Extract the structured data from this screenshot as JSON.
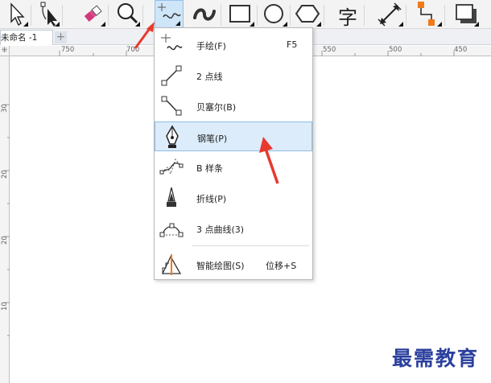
{
  "toolbar": {
    "tools": [
      {
        "name": "pick-tool"
      },
      {
        "name": "shape-tool"
      },
      {
        "name": "crop-tool"
      },
      {
        "name": "zoom-tool"
      },
      {
        "name": "freehand-tool",
        "active": true
      },
      {
        "name": "artistic-media-tool"
      },
      {
        "name": "rectangle-tool"
      },
      {
        "name": "ellipse-tool"
      },
      {
        "name": "polygon-tool"
      },
      {
        "name": "text-tool",
        "glyph": "字"
      },
      {
        "name": "parallel-dimension-tool"
      },
      {
        "name": "connector-tool"
      },
      {
        "name": "shadow-tool"
      }
    ]
  },
  "document": {
    "tab_label": "未命名 -1",
    "add_tab": "+"
  },
  "ruler": {
    "corner_mark": "⁜",
    "h_labels": [
      "750",
      "700",
      "550",
      "500",
      "450"
    ],
    "v_labels": [
      "30",
      "20",
      "20",
      "10"
    ]
  },
  "menu": {
    "items": [
      {
        "icon": "freehand-icon",
        "label": "手绘(F)",
        "shortcut": "F5"
      },
      {
        "icon": "two-point-line-icon",
        "label": "2 点线",
        "shortcut": ""
      },
      {
        "icon": "bezier-icon",
        "label": "贝塞尔(B)",
        "shortcut": ""
      },
      {
        "icon": "pen-icon",
        "label": "钢笔(P)",
        "shortcut": "",
        "highlighted": true
      },
      {
        "icon": "b-spline-icon",
        "label": "B 样条",
        "shortcut": ""
      },
      {
        "icon": "polyline-icon",
        "label": "折线(P)",
        "shortcut": ""
      },
      {
        "icon": "three-point-curve-icon",
        "label": "3 点曲线(3)",
        "shortcut": ""
      },
      {
        "icon": "smart-drawing-icon",
        "label": "智能绘图(S)",
        "shortcut": "位移+S"
      }
    ]
  },
  "watermark": "最需教育",
  "colors": {
    "accent_highlight": "#dcecfb",
    "annotation_arrow": "#e8392e",
    "watermark": "#2b3f9e"
  }
}
